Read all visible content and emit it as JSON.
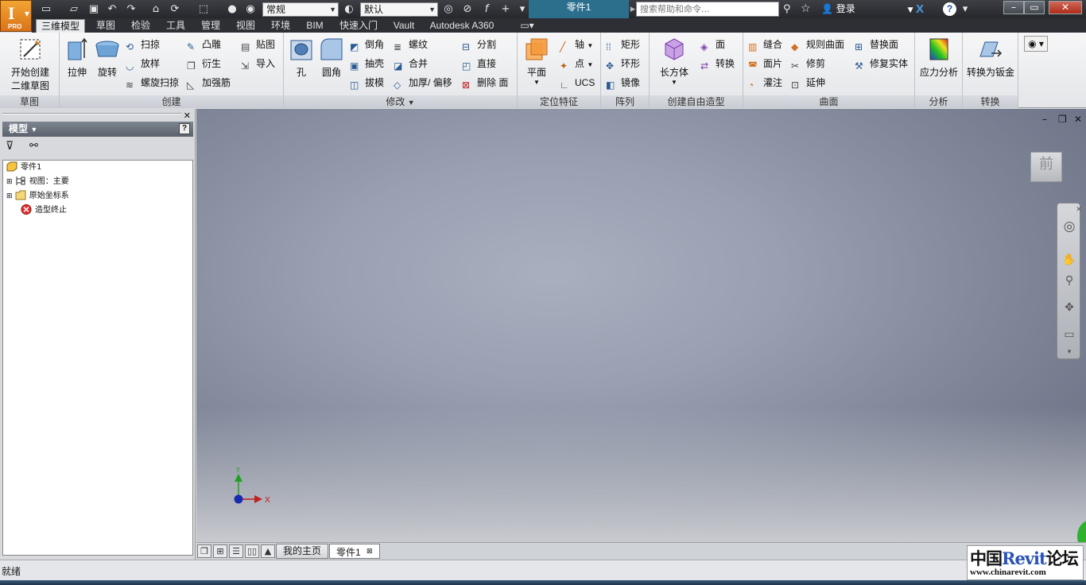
{
  "titlebar": {
    "logo_letter": "I",
    "logo_badge": "PRO",
    "material_value": "常规",
    "appearance_value": "默认",
    "document_title": "零件1",
    "search_placeholder": "搜索帮助和命令...",
    "signin_label": "登录"
  },
  "tabs": [
    "三维模型",
    "草图",
    "检验",
    "工具",
    "管理",
    "视图",
    "环境",
    "BIM",
    "快速入门",
    "Vault",
    "Autodesk A360"
  ],
  "active_tab": "三维模型",
  "ribbon": {
    "sketch": {
      "title": "草图",
      "start_sketch_line1": "开始创建",
      "start_sketch_line2": "二维草图"
    },
    "create": {
      "title": "创建",
      "extrude": "拉伸",
      "revolve": "旋转",
      "sweep": "扫掠",
      "loft": "放样",
      "coil": "螺旋扫掠",
      "emboss": "凸雕",
      "derive": "衍生",
      "rib": "加强筋",
      "decal": "贴图",
      "import": "导入"
    },
    "modify": {
      "title": "修改",
      "hole": "孔",
      "fillet": "圆角",
      "chamfer": "倒角",
      "shell": "抽壳",
      "draft": "拔模",
      "thread": "螺纹",
      "combine": "合并",
      "thicken": "加厚/ 偏移",
      "split": "分割",
      "direct": "直接",
      "delete_face": "删除 面"
    },
    "work_features": {
      "title": "定位特征",
      "plane": "平面",
      "axis": "轴",
      "point": "点",
      "ucs": "UCS"
    },
    "pattern": {
      "title": "阵列",
      "rectangular": "矩形",
      "circular": "环形",
      "mirror": "镜像"
    },
    "freeform": {
      "title": "创建自由造型",
      "box": "长方体",
      "face": "面",
      "convert": "转换"
    },
    "surface": {
      "title": "曲面",
      "stitch": "缝合",
      "patch": "面片",
      "sculpt": "灌注",
      "ruled": "规则曲面",
      "trim": "修剪",
      "extend": "延伸",
      "replace_face": "替换面",
      "repair": "修复实体"
    },
    "analysis": {
      "title": "分析",
      "stress": "应力分析"
    },
    "convert": {
      "title": "转换",
      "to_sheet_metal": "转换为钣金"
    }
  },
  "browser": {
    "header": "模型",
    "tree": [
      {
        "label": "零件1"
      },
      {
        "label": "视图：主要"
      },
      {
        "label": "原始坐标系"
      },
      {
        "label": "造型终止"
      }
    ]
  },
  "viewport": {
    "viewcube_label": "前",
    "triad_x": "X",
    "triad_y": "Y"
  },
  "doc_tabs": [
    "我的主页",
    "零件1"
  ],
  "status": {
    "text": "就绪"
  },
  "watermark": {
    "line1_a": "中国",
    "line1_b": "Revit",
    "line1_c": "论坛",
    "line2": "www.chinarevit.com"
  }
}
